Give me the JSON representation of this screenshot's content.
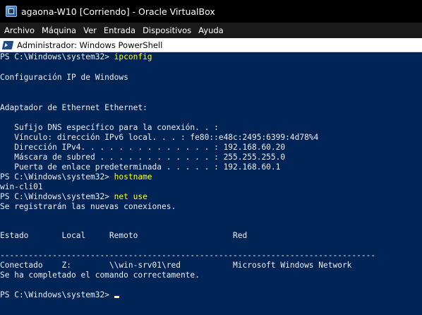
{
  "window": {
    "title": "agaona-W10 [Corriendo] - Oracle VirtualBox"
  },
  "menubar": {
    "items": [
      "Archivo",
      "Máquina",
      "Ver",
      "Entrada",
      "Dispositivos",
      "Ayuda"
    ]
  },
  "powershell": {
    "title": "Administrador: Windows PowerShell",
    "prompt": "PS C:\\Windows\\system32> ",
    "commands": {
      "ipconfig": "ipconfig",
      "hostname": "hostname",
      "net_use": "net use"
    },
    "output": {
      "ip_config_header": "Configuración IP de Windows",
      "adapter": "Adaptador de Ethernet Ethernet:",
      "dns_suffix": "   Sufijo DNS específico para la conexión. . :",
      "ipv6": "   Vínculo: dirección IPv6 local. . . : fe80::e48c:2495:6399:4d78%4",
      "ipv4": "   Dirección IPv4. . . . . . . . . . . . . . : 192.168.60.20",
      "mask": "   Máscara de subred . . . . . . . . . . . . : 255.255.255.0",
      "gateway": "   Puerta de enlace predeterminada . . . . . : 192.168.60.1",
      "hostname_result": "win-cli01",
      "new_connections": "Se registrarán las nuevas conexiones.",
      "table_header": "Estado       Local     Remoto                    Red",
      "separator": "-------------------------------------------------------------------------------",
      "table_row": "Conectado    Z:        \\\\win-srv01\\red           Microsoft Windows Network",
      "completed": "Se ha completado el comando correctamente."
    }
  }
}
